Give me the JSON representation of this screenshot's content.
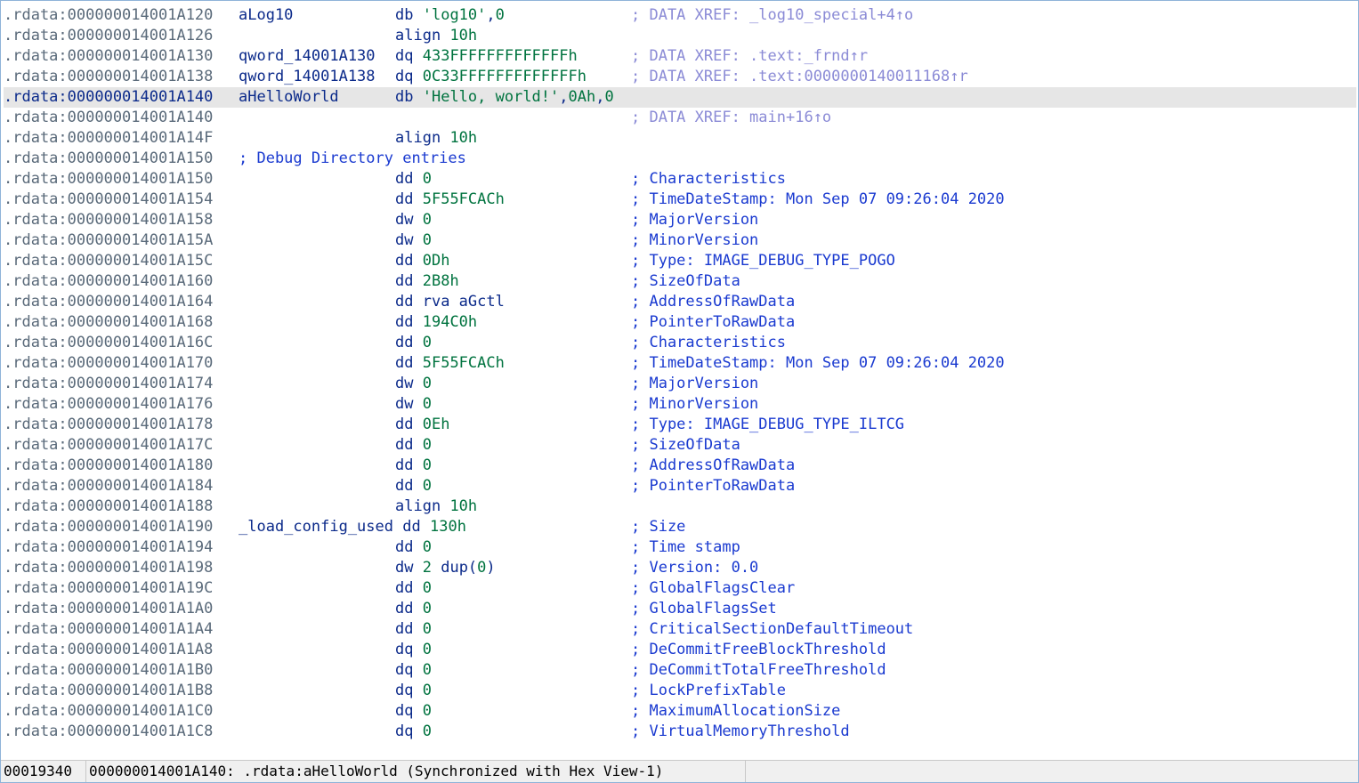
{
  "listing": [
    {
      "addr": ".rdata:000000014001A120",
      "label": "aLog10",
      "mnem": "db",
      "ops": [
        {
          "t": "'log10'",
          "c": "str"
        },
        {
          "t": ",",
          "c": "operand"
        },
        {
          "t": "0",
          "c": "num"
        }
      ],
      "xref": "; DATA XREF: _log10_special+4↑o"
    },
    {
      "addr": ".rdata:000000014001A126",
      "label": "",
      "mnem": "align",
      "ops": [
        {
          "t": "10h",
          "c": "num"
        }
      ]
    },
    {
      "addr": ".rdata:000000014001A130",
      "label": "qword_14001A130",
      "mnem": "dq",
      "ops": [
        {
          "t": "433FFFFFFFFFFFFFh",
          "c": "num"
        }
      ],
      "xref": "; DATA XREF: .text:_frnd↑r"
    },
    {
      "addr": ".rdata:000000014001A138",
      "label": "qword_14001A138",
      "mnem": "dq",
      "ops": [
        {
          "t": "0C33FFFFFFFFFFFFFh",
          "c": "num"
        }
      ],
      "xref": "; DATA XREF: .text:0000000140011168↑r"
    },
    {
      "addr": ".rdata:000000014001A140",
      "label": "aHelloWorld",
      "mnem": "db",
      "ops": [
        {
          "t": "'Hello, world!'",
          "c": "str"
        },
        {
          "t": ",",
          "c": "operand"
        },
        {
          "t": "0Ah",
          "c": "num"
        },
        {
          "t": ",",
          "c": "operand"
        },
        {
          "t": "0",
          "c": "num"
        }
      ],
      "selected": true
    },
    {
      "addr": ".rdata:000000014001A140",
      "label": "",
      "mnem": "",
      "ops": [],
      "xref": "; DATA XREF: main+16↑o"
    },
    {
      "addr": ".rdata:000000014001A14F",
      "label": "",
      "mnem": "align",
      "ops": [
        {
          "t": "10h",
          "c": "num"
        }
      ]
    },
    {
      "addr": ".rdata:000000014001A150",
      "label": "",
      "mnem": "",
      "ops": [],
      "line_comment": "; Debug Directory entries"
    },
    {
      "addr": ".rdata:000000014001A150",
      "label": "",
      "mnem": "dd",
      "ops": [
        {
          "t": "0",
          "c": "num"
        }
      ],
      "comment": "; Characteristics"
    },
    {
      "addr": ".rdata:000000014001A154",
      "label": "",
      "mnem": "dd",
      "ops": [
        {
          "t": "5F55FCACh",
          "c": "num"
        }
      ],
      "comment": "; TimeDateStamp: Mon Sep 07 09:26:04 2020"
    },
    {
      "addr": ".rdata:000000014001A158",
      "label": "",
      "mnem": "dw",
      "ops": [
        {
          "t": "0",
          "c": "num"
        }
      ],
      "comment": "; MajorVersion"
    },
    {
      "addr": ".rdata:000000014001A15A",
      "label": "",
      "mnem": "dw",
      "ops": [
        {
          "t": "0",
          "c": "num"
        }
      ],
      "comment": "; MinorVersion"
    },
    {
      "addr": ".rdata:000000014001A15C",
      "label": "",
      "mnem": "dd",
      "ops": [
        {
          "t": "0Dh",
          "c": "num"
        }
      ],
      "comment": "; Type: IMAGE_DEBUG_TYPE_POGO"
    },
    {
      "addr": ".rdata:000000014001A160",
      "label": "",
      "mnem": "dd",
      "ops": [
        {
          "t": "2B8h",
          "c": "num"
        }
      ],
      "comment": "; SizeOfData"
    },
    {
      "addr": ".rdata:000000014001A164",
      "label": "",
      "mnem": "dd",
      "ops": [
        {
          "t": "rva aGctl",
          "c": "operand"
        }
      ],
      "comment": "; AddressOfRawData"
    },
    {
      "addr": ".rdata:000000014001A168",
      "label": "",
      "mnem": "dd",
      "ops": [
        {
          "t": "194C0h",
          "c": "num"
        }
      ],
      "comment": "; PointerToRawData"
    },
    {
      "addr": ".rdata:000000014001A16C",
      "label": "",
      "mnem": "dd",
      "ops": [
        {
          "t": "0",
          "c": "num"
        }
      ],
      "comment": "; Characteristics"
    },
    {
      "addr": ".rdata:000000014001A170",
      "label": "",
      "mnem": "dd",
      "ops": [
        {
          "t": "5F55FCACh",
          "c": "num"
        }
      ],
      "comment": "; TimeDateStamp: Mon Sep 07 09:26:04 2020"
    },
    {
      "addr": ".rdata:000000014001A174",
      "label": "",
      "mnem": "dw",
      "ops": [
        {
          "t": "0",
          "c": "num"
        }
      ],
      "comment": "; MajorVersion"
    },
    {
      "addr": ".rdata:000000014001A176",
      "label": "",
      "mnem": "dw",
      "ops": [
        {
          "t": "0",
          "c": "num"
        }
      ],
      "comment": "; MinorVersion"
    },
    {
      "addr": ".rdata:000000014001A178",
      "label": "",
      "mnem": "dd",
      "ops": [
        {
          "t": "0Eh",
          "c": "num"
        }
      ],
      "comment": "; Type: IMAGE_DEBUG_TYPE_ILTCG"
    },
    {
      "addr": ".rdata:000000014001A17C",
      "label": "",
      "mnem": "dd",
      "ops": [
        {
          "t": "0",
          "c": "num"
        }
      ],
      "comment": "; SizeOfData"
    },
    {
      "addr": ".rdata:000000014001A180",
      "label": "",
      "mnem": "dd",
      "ops": [
        {
          "t": "0",
          "c": "num"
        }
      ],
      "comment": "; AddressOfRawData"
    },
    {
      "addr": ".rdata:000000014001A184",
      "label": "",
      "mnem": "dd",
      "ops": [
        {
          "t": "0",
          "c": "num"
        }
      ],
      "comment": "; PointerToRawData"
    },
    {
      "addr": ".rdata:000000014001A188",
      "label": "",
      "mnem": "align",
      "ops": [
        {
          "t": "10h",
          "c": "num"
        }
      ]
    },
    {
      "addr": ".rdata:000000014001A190",
      "label": "_load_config_used",
      "mnem": "dd",
      "inline": true,
      "ops": [
        {
          "t": "130h",
          "c": "num"
        }
      ],
      "comment": "; Size"
    },
    {
      "addr": ".rdata:000000014001A194",
      "label": "",
      "mnem": "dd",
      "ops": [
        {
          "t": "0",
          "c": "num"
        }
      ],
      "comment": "; Time stamp"
    },
    {
      "addr": ".rdata:000000014001A198",
      "label": "",
      "mnem": "dw",
      "ops": [
        {
          "t": "2",
          "c": "num"
        },
        {
          "t": " dup(",
          "c": "operand"
        },
        {
          "t": "0",
          "c": "num"
        },
        {
          "t": ")",
          "c": "operand"
        }
      ],
      "comment": "; Version: 0.0"
    },
    {
      "addr": ".rdata:000000014001A19C",
      "label": "",
      "mnem": "dd",
      "ops": [
        {
          "t": "0",
          "c": "num"
        }
      ],
      "comment": "; GlobalFlagsClear"
    },
    {
      "addr": ".rdata:000000014001A1A0",
      "label": "",
      "mnem": "dd",
      "ops": [
        {
          "t": "0",
          "c": "num"
        }
      ],
      "comment": "; GlobalFlagsSet"
    },
    {
      "addr": ".rdata:000000014001A1A4",
      "label": "",
      "mnem": "dd",
      "ops": [
        {
          "t": "0",
          "c": "num"
        }
      ],
      "comment": "; CriticalSectionDefaultTimeout"
    },
    {
      "addr": ".rdata:000000014001A1A8",
      "label": "",
      "mnem": "dq",
      "ops": [
        {
          "t": "0",
          "c": "num"
        }
      ],
      "comment": "; DeCommitFreeBlockThreshold"
    },
    {
      "addr": ".rdata:000000014001A1B0",
      "label": "",
      "mnem": "dq",
      "ops": [
        {
          "t": "0",
          "c": "num"
        }
      ],
      "comment": "; DeCommitTotalFreeThreshold"
    },
    {
      "addr": ".rdata:000000014001A1B8",
      "label": "",
      "mnem": "dq",
      "ops": [
        {
          "t": "0",
          "c": "num"
        }
      ],
      "comment": "; LockPrefixTable"
    },
    {
      "addr": ".rdata:000000014001A1C0",
      "label": "",
      "mnem": "dq",
      "ops": [
        {
          "t": "0",
          "c": "num"
        }
      ],
      "comment": "; MaximumAllocationSize"
    },
    {
      "addr": ".rdata:000000014001A1C8",
      "label": "",
      "mnem": "dq",
      "ops": [
        {
          "t": "0",
          "c": "num"
        }
      ],
      "comment": "; VirtualMemoryThreshold"
    }
  ],
  "statusbar": {
    "offset": "00019340",
    "location": "000000014001A140: .rdata:aHelloWorld (Synchronized with Hex View-1)"
  },
  "colors": {
    "address": "#5a6a7a",
    "name": "#0b2a8a",
    "number_string": "#00733f",
    "comment": "#1a3ad0",
    "xref": "#8b8bd6",
    "selection": "#e6e6e6"
  }
}
